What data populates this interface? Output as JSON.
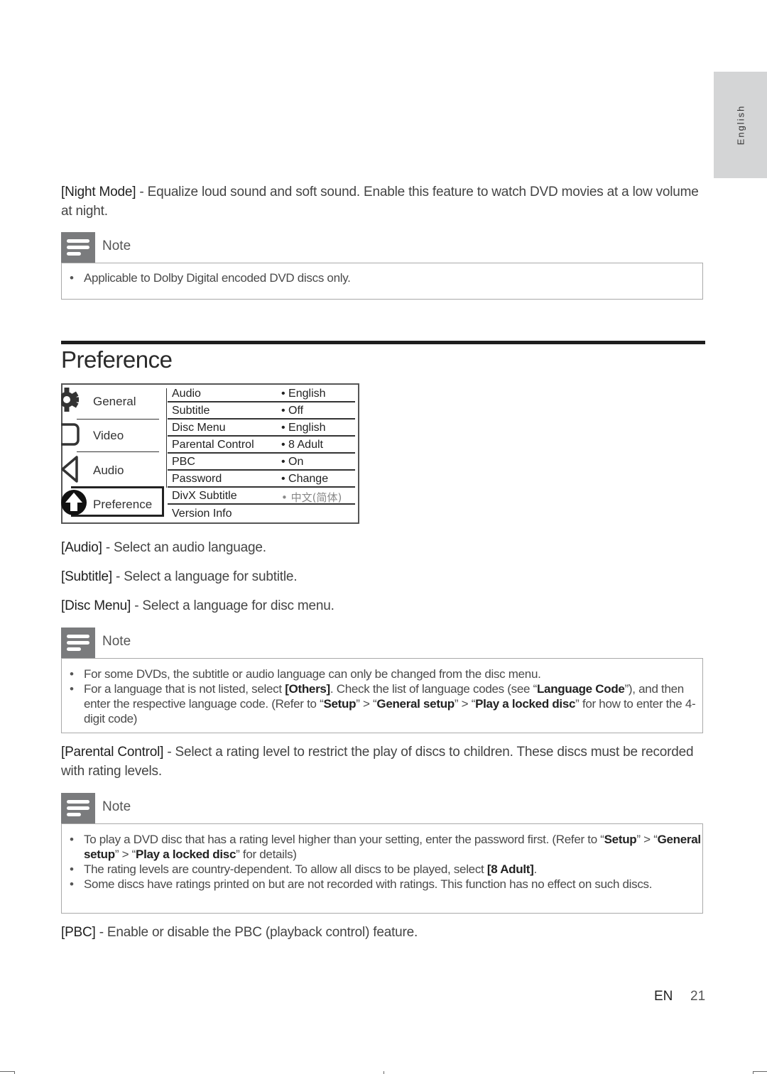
{
  "side_tab": {
    "label": "English"
  },
  "night_mode": {
    "term": "[Night Mode]",
    "text": " - Equalize loud sound and soft sound. Enable this feature to watch DVD movies at a low volume at night."
  },
  "note1": {
    "title": "Note",
    "items": [
      "Applicable to Dolby Digital encoded DVD discs only."
    ]
  },
  "section": {
    "title": "Preference"
  },
  "menu": {
    "categories": [
      {
        "label": "General",
        "icon": "gear-icon"
      },
      {
        "label": "Video",
        "icon": "video-icon"
      },
      {
        "label": "Audio",
        "icon": "speaker-icon"
      },
      {
        "label": "Preference",
        "icon": "preference-icon",
        "selected": true
      }
    ],
    "rows": [
      {
        "label": "Audio",
        "value": "• English"
      },
      {
        "label": "Subtitle",
        "value": "• Off"
      },
      {
        "label": "Disc Menu",
        "value": "• English"
      },
      {
        "label": "Parental Control",
        "value": "• 8 Adult"
      },
      {
        "label": "PBC",
        "value": "• On"
      },
      {
        "label": "Password",
        "value": "• Change"
      },
      {
        "label": "DivX Subtitle",
        "value": "• 中文(简体)"
      },
      {
        "label": "Version Info",
        "value": ""
      }
    ]
  },
  "descriptions": {
    "audio": {
      "term": "[Audio]",
      "text": " - Select an audio language."
    },
    "subtitle": {
      "term": "[Subtitle]",
      "text": " - Select a language for subtitle."
    },
    "disc_menu": {
      "term": "[Disc Menu]",
      "text": " - Select a language for disc menu."
    }
  },
  "note2": {
    "title": "Note",
    "item1": "For some DVDs, the subtitle or audio language can only be changed from the disc menu.",
    "item2": {
      "p1": "For a language that is not listed, select ",
      "others": "[Others]",
      "p2": ". Check the list of language codes (see “",
      "lang_code": "Language Code",
      "p3": "”), and then enter the respective language code. (Refer to “",
      "setup": "Setup",
      "p4": "” > “",
      "general_setup": "General setup",
      "p5": "” > “",
      "play_locked": "Play a locked disc",
      "p6": "” for how to enter the 4-digit code)"
    }
  },
  "parental": {
    "term": "[Parental Control]",
    "text": " - Select a rating level to restrict the play of discs to children. These discs must be recorded with rating levels."
  },
  "note3": {
    "title": "Note",
    "item1": {
      "p1": "To play a DVD disc that has a rating level higher than your setting, enter the password first. (Refer to “",
      "setup": "Setup",
      "p2": "” > “",
      "general_setup": "General setup",
      "p3": "” > “",
      "play_locked": "Play a locked disc",
      "p4": "” for details)"
    },
    "item2": {
      "p1": "The rating levels are country-dependent. To allow all discs to be played, select ",
      "adult": "[8 Adult]",
      "p2": "."
    },
    "item3": "Some discs have ratings printed on but are not recorded with ratings. This function has no effect on such discs."
  },
  "pbc": {
    "term": "[PBC]",
    "text": " - Enable or disable the PBC (playback control) feature."
  },
  "footer": {
    "lang": "EN",
    "page": "21"
  }
}
